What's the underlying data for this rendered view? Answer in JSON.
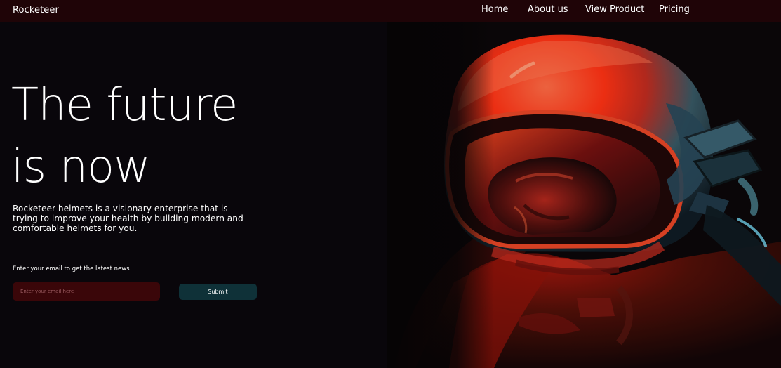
{
  "navbar": {
    "brand": "Rocketeer",
    "links": [
      "Home",
      "About us",
      "View Product",
      "Pricing"
    ]
  },
  "hero": {
    "headline_line1": "The future",
    "headline_line2": "is now",
    "description": "Rocketeer helmets is a visionary enterprise that is trying to improve your health by building modern and comfortable helmets for you.",
    "image_subject": "astronaut-helmet-photo"
  },
  "signup": {
    "prompt": "Enter your email to get the latest news",
    "email_placeholder": "Enter your email here",
    "submit_label": "Submit"
  },
  "colors": {
    "page_background": "#09060b",
    "navbar_background": "#1f0407",
    "input_background": "#3a0609",
    "button_background": "#0f3138",
    "photo_red": "#ff3b1d",
    "photo_teal": "#2f7d92"
  }
}
